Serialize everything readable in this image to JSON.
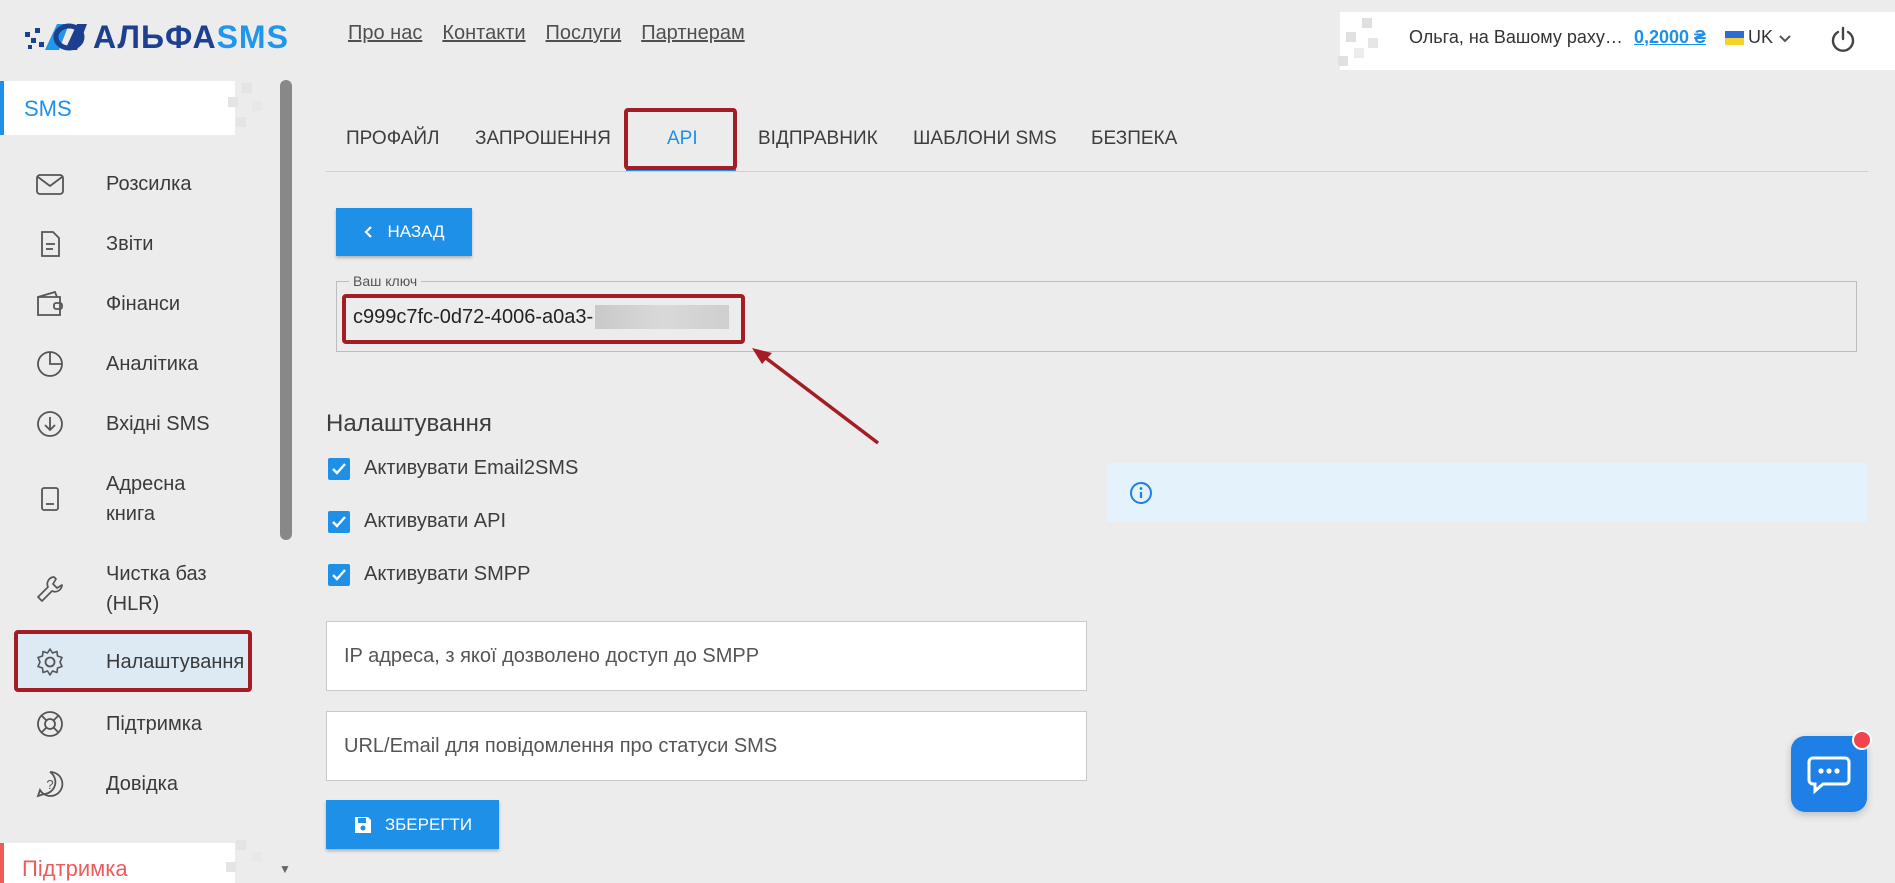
{
  "brand": {
    "logo_part1": "АЛЬФА",
    "logo_part2": "SMS",
    "primary": "#1e90e8",
    "dark_blue": "#1c3f8f"
  },
  "topnav": [
    {
      "label": "Про нас"
    },
    {
      "label": "Контакти"
    },
    {
      "label": "Послуги"
    },
    {
      "label": "Партнерам"
    }
  ],
  "account": {
    "greeting": "Ольга, на Вашому раху…",
    "balance": "0,2000 ₴",
    "language": "UK"
  },
  "sidebar": {
    "section_label": "SMS",
    "items": [
      {
        "label": "Розсилка",
        "icon": "envelope-icon"
      },
      {
        "label": "Звіти",
        "icon": "document-icon"
      },
      {
        "label": "Фінанси",
        "icon": "wallet-icon"
      },
      {
        "label": "Аналітика",
        "icon": "pie-chart-icon"
      },
      {
        "label": "Вхідні SMS",
        "icon": "download-circle-icon"
      },
      {
        "label": "Адресна книга",
        "icon": "address-book-icon"
      },
      {
        "label": "Чистка баз (HLR)",
        "icon": "wrench-icon"
      },
      {
        "label": "Налаштування",
        "icon": "gear-icon"
      },
      {
        "label": "Підтримка",
        "icon": "lifebuoy-icon"
      },
      {
        "label": "Довідка",
        "icon": "help-circle-icon"
      }
    ],
    "bottom_label": "Підтримка"
  },
  "tabs": [
    {
      "label": "Профайл"
    },
    {
      "label": "Запрошення"
    },
    {
      "label": "API"
    },
    {
      "label": "Відправник"
    },
    {
      "label": "Шаблони SMS"
    },
    {
      "label": "Безпека"
    }
  ],
  "back_label": "Назад",
  "key": {
    "legend": "Ваш ключ",
    "value": "c999c7fc-0d72-4006-a0a3-"
  },
  "settings": {
    "title": "Налаштування",
    "checks": [
      {
        "label": "Активувати Email2SMS",
        "checked": true
      },
      {
        "label": "Активувати API",
        "checked": true
      },
      {
        "label": "Активувати SMPP",
        "checked": true
      }
    ],
    "ip_placeholder": "IP адреса, з якої дозволено доступ до SMPP",
    "url_placeholder": "URL/Email для повідомлення про статуси SMS",
    "save_label": "Зберегти"
  }
}
